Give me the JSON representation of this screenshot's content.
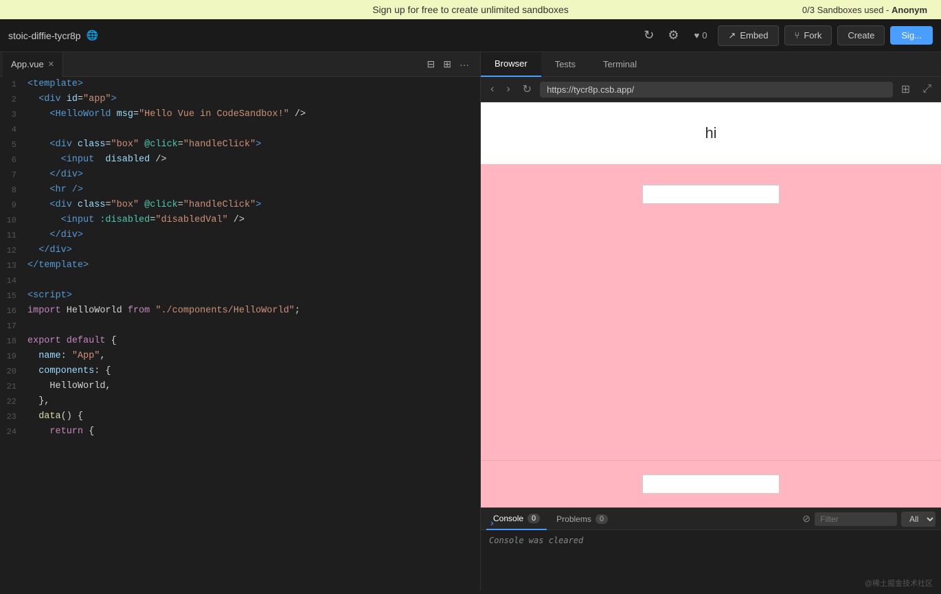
{
  "banner": {
    "text": "Sign up for free to create unlimited sandboxes",
    "right_text": "0/3 Sandboxes used - ",
    "user": "Anonym"
  },
  "header": {
    "project_name": "stoic-diffie-tycr8p",
    "heart_count": "0",
    "embed_label": "Embed",
    "fork_label": "Fork",
    "create_label": "Create",
    "sign_label": "Sig..."
  },
  "editor": {
    "tab_label": "App.vue",
    "lines": [
      {
        "num": 1,
        "code": "<template>"
      },
      {
        "num": 2,
        "code": "  <div id=\"app\">"
      },
      {
        "num": 3,
        "code": "    <HelloWorld msg=\"Hello Vue in CodeSandbox!\" />"
      },
      {
        "num": 4,
        "code": ""
      },
      {
        "num": 5,
        "code": "    <div class=\"box\" @click=\"handleClick\">"
      },
      {
        "num": 6,
        "code": "      <input  disabled />"
      },
      {
        "num": 7,
        "code": "    </div>"
      },
      {
        "num": 8,
        "code": "    <hr />"
      },
      {
        "num": 9,
        "code": "    <div class=\"box\" @click=\"handleClick\">"
      },
      {
        "num": 10,
        "code": "      <input :disabled=\"disabledVal\" />"
      },
      {
        "num": 11,
        "code": "    </div>"
      },
      {
        "num": 12,
        "code": "  </div>"
      },
      {
        "num": 13,
        "code": "</template>"
      },
      {
        "num": 14,
        "code": ""
      },
      {
        "num": 15,
        "code": "<script>"
      },
      {
        "num": 16,
        "code": "import HelloWorld from \"./components/HelloWorld\";"
      },
      {
        "num": 17,
        "code": ""
      },
      {
        "num": 18,
        "code": "export default {"
      },
      {
        "num": 19,
        "code": "  name: \"App\","
      },
      {
        "num": 20,
        "code": "  components: {"
      },
      {
        "num": 21,
        "code": "    HelloWorld,"
      },
      {
        "num": 22,
        "code": "  },"
      },
      {
        "num": 23,
        "code": "  data() {"
      },
      {
        "num": 24,
        "code": "    return {"
      }
    ]
  },
  "browser": {
    "tabs": [
      "Browser",
      "Tests",
      "Terminal"
    ],
    "active_tab": "Browser",
    "url": "https://tycr8p.csb.app/",
    "preview_text": "hi",
    "console_cleared": "Console was cleared"
  },
  "console": {
    "tab_label": "Console",
    "tab_count": "0",
    "problems_label": "Problems",
    "problems_count": "0",
    "filter_placeholder": "Filter",
    "filter_option": "All"
  },
  "watermark": {
    "text": "@稀土掘金技术社区"
  }
}
